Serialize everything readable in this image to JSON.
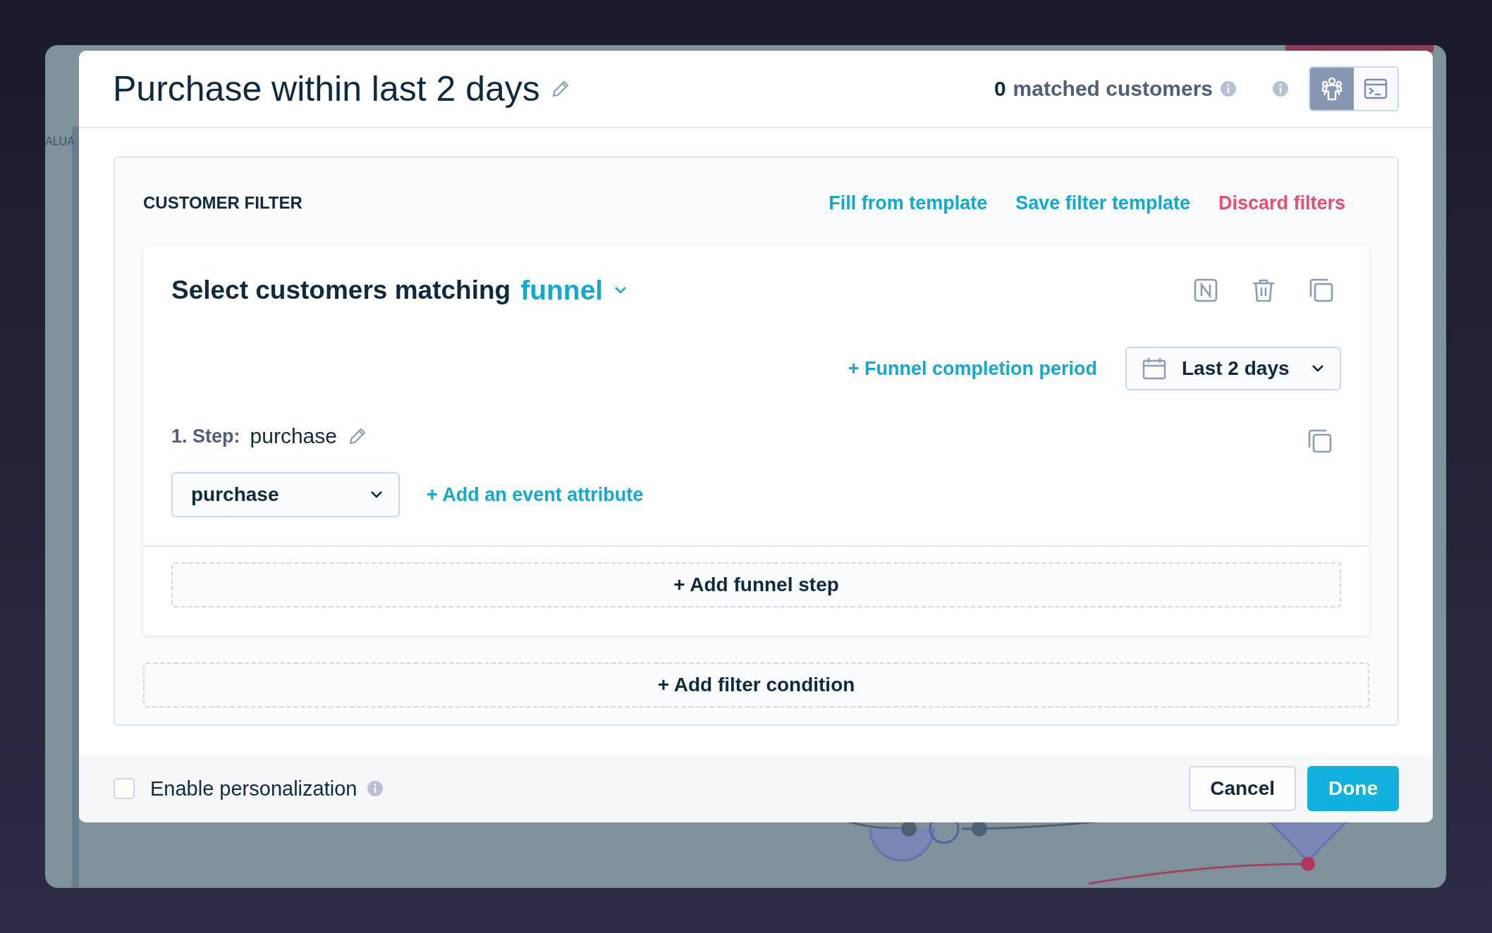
{
  "background": {
    "side_label": "ALUA"
  },
  "modal": {
    "title": "Purchase within last 2 days",
    "matched": {
      "count": "0",
      "label": "matched customers"
    },
    "view_toggle": [
      {
        "kind": "audience",
        "selected": true
      },
      {
        "kind": "code",
        "selected": false
      }
    ]
  },
  "filter": {
    "heading": "CUSTOMER FILTER",
    "actions": [
      {
        "label": "Fill from template",
        "kind": "normal"
      },
      {
        "label": "Save filter template",
        "kind": "normal"
      },
      {
        "label": "Discard filters",
        "kind": "danger"
      }
    ],
    "condition": {
      "prefix": "Select customers matching",
      "mode": "funnel",
      "completion_link": "+ Funnel completion period",
      "period": "Last 2 days",
      "steps": [
        {
          "number": "1. Step:",
          "name": "purchase",
          "event": "purchase",
          "add_attribute": "+ Add an event attribute"
        }
      ],
      "add_step": "+ Add funnel step"
    },
    "add_condition": "+ Add filter condition"
  },
  "footer": {
    "personalization": {
      "label": "Enable personalization",
      "checked": false
    },
    "buttons": [
      {
        "label": "Cancel",
        "kind": "secondary"
      },
      {
        "label": "Done",
        "kind": "primary"
      }
    ]
  }
}
